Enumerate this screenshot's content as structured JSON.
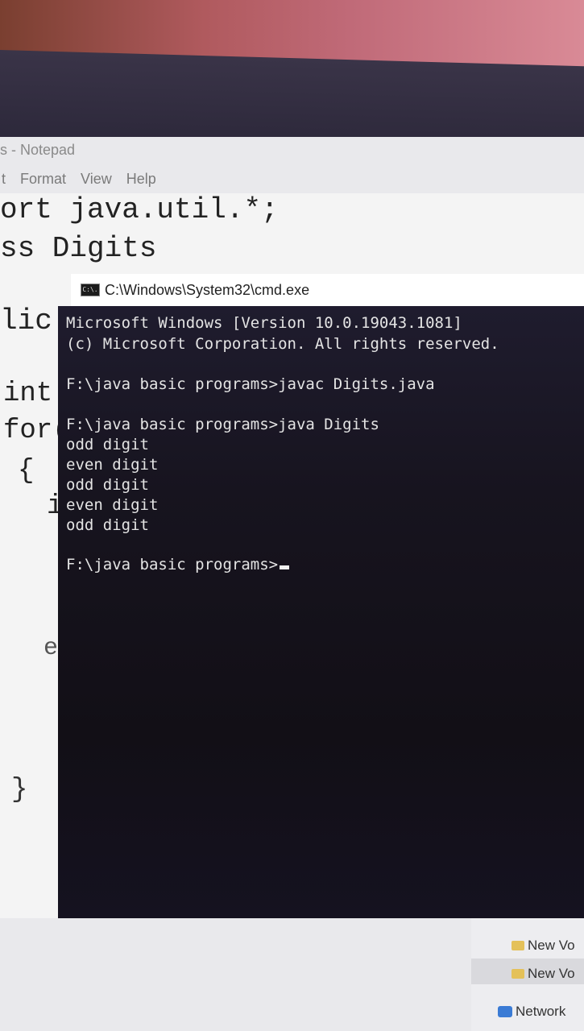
{
  "notepad": {
    "title": "s - Notepad",
    "menu": [
      "t",
      "Format",
      "View",
      "Help"
    ],
    "code_lines": [
      "ort java.util.*;",
      "ss Digits",
      "lic",
      "int",
      "for(",
      "{",
      "i",
      "e",
      "}"
    ]
  },
  "cmd": {
    "title": "C:\\Windows\\System32\\cmd.exe",
    "icon_label": "C:\\.",
    "lines": [
      "Microsoft Windows [Version 10.0.19043.1081]",
      "(c) Microsoft Corporation. All rights reserved.",
      "F:\\java basic programs>javac Digits.java",
      "F:\\java basic programs>java Digits",
      "odd digit",
      "even digit",
      "odd digit",
      "even digit",
      "odd digit",
      "F:\\java basic programs>"
    ]
  },
  "explorer": {
    "items": [
      "New Vo",
      "New Vo",
      "Network"
    ]
  }
}
